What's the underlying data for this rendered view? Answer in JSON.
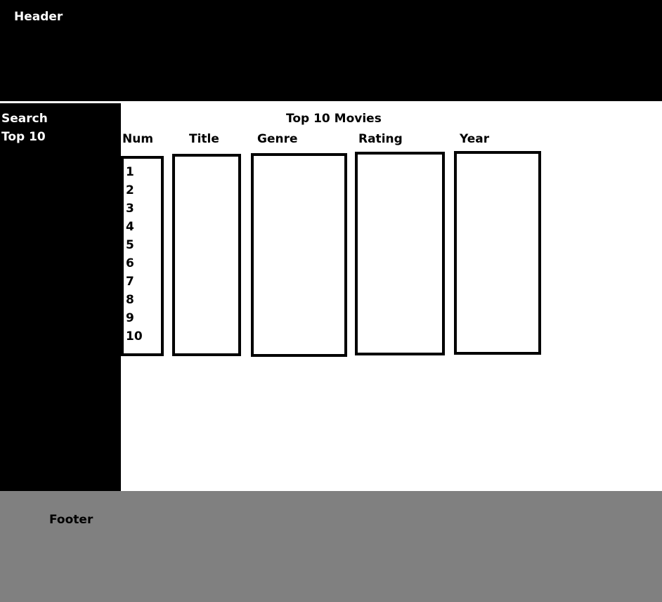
{
  "header": {
    "title": "Header"
  },
  "sidebar": {
    "items": [
      {
        "label": "Search"
      },
      {
        "label": "Top 10"
      }
    ]
  },
  "main": {
    "title": "Top 10 Movies",
    "columns": [
      {
        "label": "Num"
      },
      {
        "label": "Title"
      },
      {
        "label": "Genre"
      },
      {
        "label": "Rating"
      },
      {
        "label": "Year"
      }
    ],
    "numbers": [
      "1",
      "2",
      "3",
      "4",
      "5",
      "6",
      "7",
      "8",
      "9",
      "10"
    ]
  },
  "footer": {
    "label": "Footer"
  }
}
